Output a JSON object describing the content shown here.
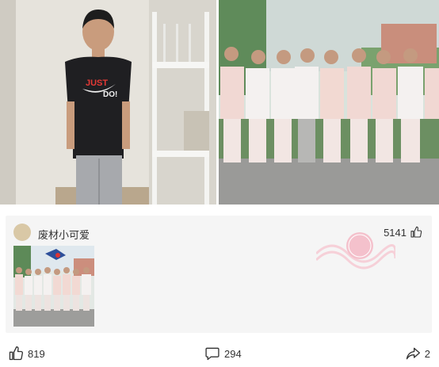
{
  "comment": {
    "user_name": "废材小可爱",
    "like_count": "5141"
  },
  "actions": {
    "like_count": "819",
    "comment_count": "294",
    "share_count": "2"
  },
  "icons": {
    "like": "thumbs-up-icon",
    "comment": "speech-bubble-icon",
    "share": "share-arrow-icon"
  },
  "colors": {
    "card_background": "#f5f5f5",
    "stamp_pink": "#f3b7c4"
  }
}
